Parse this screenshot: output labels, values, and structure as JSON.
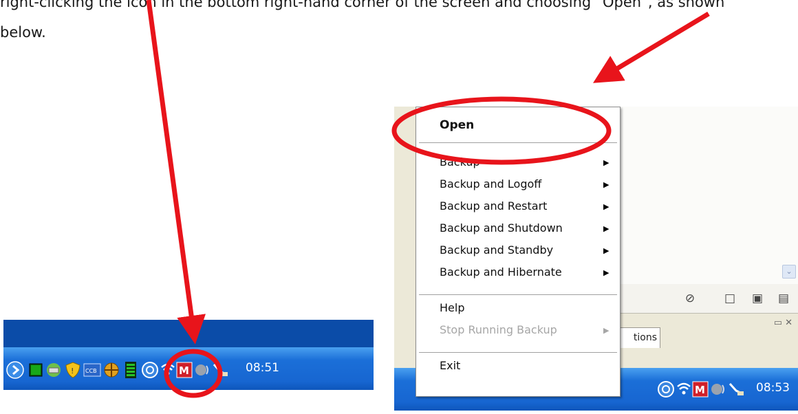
{
  "document": {
    "line1": "right-clicking the icon in the bottom right-hand corner of the screen and choosing “Open”, as shown",
    "line2": "below."
  },
  "left_screenshot": {
    "clock": "08:51",
    "tray_icons": [
      "start-arrow-icon",
      "green-grid-icon",
      "printer-icon",
      "shield-icon",
      "ccb-icon",
      "crosshair-icon",
      "green-bars-icon",
      "backup-target-icon",
      "wireless-icon",
      "mcafee-icon",
      "speaker-icon",
      "network-icon"
    ]
  },
  "right_screenshot": {
    "clock": "08:53",
    "context_menu": {
      "open": "Open",
      "items": [
        {
          "label": "Backup",
          "submenu": true
        },
        {
          "label": "Backup and Logoff",
          "submenu": true
        },
        {
          "label": "Backup and Restart",
          "submenu": true
        },
        {
          "label": "Backup and Shutdown",
          "submenu": true
        },
        {
          "label": "Backup and Standby",
          "submenu": true
        },
        {
          "label": "Backup and Hibernate",
          "submenu": true
        }
      ],
      "help": "Help",
      "stop_running_backup": "Stop Running Backup",
      "exit": "Exit"
    },
    "options_tab": "tions",
    "submenu_glyph": "▶"
  },
  "colors": {
    "annotation_red": "#e8141b",
    "taskbar_blue": "#1766d1",
    "desktop_blue": "#0b4ca8"
  }
}
